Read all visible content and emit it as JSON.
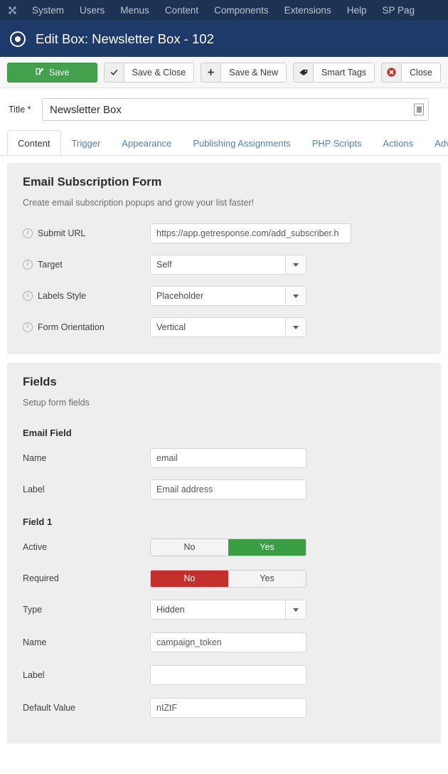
{
  "adminbar": {
    "logo_icon": "joomla-logo-icon",
    "items": [
      {
        "label": "System"
      },
      {
        "label": "Users"
      },
      {
        "label": "Menus"
      },
      {
        "label": "Content"
      },
      {
        "label": "Components"
      },
      {
        "label": "Extensions"
      },
      {
        "label": "Help"
      },
      {
        "label": "SP Pag"
      }
    ]
  },
  "titlebar": {
    "icon": "target-circle-icon",
    "title": "Edit Box: Newsletter Box - 102"
  },
  "toolbar": {
    "save": {
      "label": "Save",
      "icon": "pencil-square-icon",
      "color": "#41a14c"
    },
    "save_close": {
      "label": "Save & Close",
      "icon": "check-icon"
    },
    "save_new": {
      "label": "Save & New",
      "icon": "plus-icon"
    },
    "smart_tags": {
      "label": "Smart Tags",
      "icon": "tag-icon"
    },
    "close": {
      "label": "Close",
      "icon": "close-circle-icon"
    }
  },
  "title_field": {
    "label": "Title *",
    "value": "Newsletter Box",
    "icon": "article-icon"
  },
  "tabs": [
    {
      "label": "Content",
      "active": true
    },
    {
      "label": "Trigger",
      "active": false
    },
    {
      "label": "Appearance",
      "active": false
    },
    {
      "label": "Publishing Assignments",
      "active": false
    },
    {
      "label": "PHP Scripts",
      "active": false
    },
    {
      "label": "Actions",
      "active": false
    },
    {
      "label": "Adva",
      "active": false
    }
  ],
  "email_subscription_panel": {
    "title": "Email Subscription Form",
    "description": "Create email subscription popups and grow your list faster!",
    "rows": [
      {
        "label": "Submit URL",
        "info": true,
        "type": "text",
        "value": "https://app.getresponse.com/add_subscriber.h"
      },
      {
        "label": "Target",
        "info": true,
        "type": "select",
        "value": "Self"
      },
      {
        "label": "Labels Style",
        "info": true,
        "type": "select",
        "value": "Placeholder"
      },
      {
        "label": "Form Orientation",
        "info": true,
        "type": "select",
        "value": "Vertical"
      }
    ]
  },
  "fields_panel": {
    "title": "Fields",
    "description": "Setup form fields",
    "email_field": {
      "heading": "Email Field",
      "name": {
        "label": "Name",
        "value": "email"
      },
      "label": {
        "label": "Label",
        "value": "Email address"
      }
    },
    "field_1": {
      "heading": "Field 1",
      "active": {
        "label": "Active",
        "no": "No",
        "yes": "Yes",
        "selected": "Yes",
        "on_color": "#3a9e45"
      },
      "required": {
        "label": "Required",
        "no": "No",
        "yes": "Yes",
        "selected": "No",
        "on_color": "#c4302b"
      },
      "type": {
        "label": "Type",
        "value": "Hidden"
      },
      "name": {
        "label": "Name",
        "value": "campaign_token"
      },
      "field_label": {
        "label": "Label",
        "value": ""
      },
      "default_value": {
        "label": "Default Value",
        "value": "nIZtF"
      }
    }
  }
}
